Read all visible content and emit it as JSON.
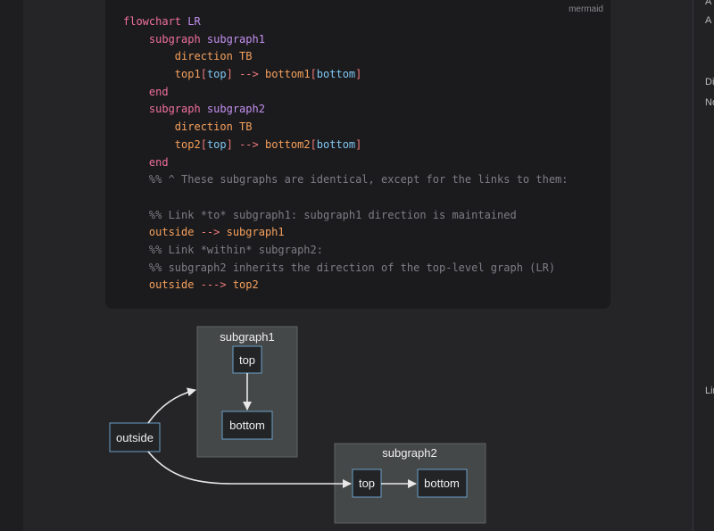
{
  "code": {
    "language": "mermaid",
    "lines": [
      [
        {
          "t": "flowchart ",
          "c": "kw"
        },
        {
          "t": "LR",
          "c": "name"
        }
      ],
      [
        {
          "t": "    subgraph ",
          "c": "kw"
        },
        {
          "t": "subgraph1",
          "c": "name"
        }
      ],
      [
        {
          "t": "        direction TB",
          "c": "node"
        }
      ],
      [
        {
          "t": "        top1",
          "c": "node"
        },
        {
          "t": "[",
          "c": "brk"
        },
        {
          "t": "top",
          "c": "label"
        },
        {
          "t": "]",
          "c": "brk"
        },
        {
          "t": " --> ",
          "c": "arrow"
        },
        {
          "t": "bottom1",
          "c": "node"
        },
        {
          "t": "[",
          "c": "brk"
        },
        {
          "t": "bottom",
          "c": "label"
        },
        {
          "t": "]",
          "c": "brk"
        }
      ],
      [
        {
          "t": "    end",
          "c": "kw"
        }
      ],
      [
        {
          "t": "    subgraph ",
          "c": "kw"
        },
        {
          "t": "subgraph2",
          "c": "name"
        }
      ],
      [
        {
          "t": "        direction TB",
          "c": "node"
        }
      ],
      [
        {
          "t": "        top2",
          "c": "node"
        },
        {
          "t": "[",
          "c": "brk"
        },
        {
          "t": "top",
          "c": "label"
        },
        {
          "t": "]",
          "c": "brk"
        },
        {
          "t": " --> ",
          "c": "arrow"
        },
        {
          "t": "bottom2",
          "c": "node"
        },
        {
          "t": "[",
          "c": "brk"
        },
        {
          "t": "bottom",
          "c": "label"
        },
        {
          "t": "]",
          "c": "brk"
        }
      ],
      [
        {
          "t": "    end",
          "c": "kw"
        }
      ],
      [
        {
          "t": "    %% ^ These subgraphs are identical, except for the links to them:",
          "c": "comment"
        }
      ],
      [
        {
          "t": " ",
          "c": "plain"
        }
      ],
      [
        {
          "t": "    %% Link *to* subgraph1: subgraph1 direction is maintained",
          "c": "comment"
        }
      ],
      [
        {
          "t": "    outside ",
          "c": "node"
        },
        {
          "t": "--> ",
          "c": "arrow"
        },
        {
          "t": "subgraph1",
          "c": "node"
        }
      ],
      [
        {
          "t": "    %% Link *within* subgraph2:",
          "c": "comment"
        }
      ],
      [
        {
          "t": "    %% subgraph2 inherits the direction of the top-level graph (LR)",
          "c": "comment"
        }
      ],
      [
        {
          "t": "    outside ",
          "c": "node"
        },
        {
          "t": "---> ",
          "c": "arrow"
        },
        {
          "t": "top2",
          "c": "node"
        }
      ]
    ]
  },
  "diagram": {
    "subgraph1": {
      "title": "subgraph1",
      "top": "top",
      "bottom": "bottom"
    },
    "subgraph2": {
      "title": "subgraph2",
      "top": "top",
      "bottom": "bottom"
    },
    "outside": "outside"
  },
  "right_panel": [
    "A",
    "A",
    "Di",
    "No",
    "Lin"
  ],
  "colors": {
    "subgraph_fill": "#454849",
    "node_fill": "#222426",
    "node_stroke": "#6aa0c8",
    "edge": "#e8e8e8"
  }
}
